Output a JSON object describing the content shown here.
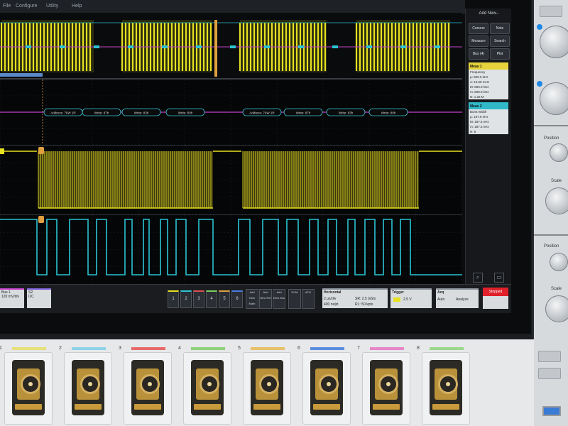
{
  "menu": {
    "items": [
      "File",
      "Configure",
      "Utility",
      "Help"
    ]
  },
  "side_panel": {
    "title": "Add New...",
    "buttons": [
      "Cursors",
      "Note",
      "Measure",
      "Search",
      "Bus (4)",
      "Plot"
    ]
  },
  "meas_badges": [
    {
      "header": "Meas 1",
      "rows": [
        "Frequency",
        "μ: 800.0 kHz",
        "σ: 10.68 mHz",
        "M: 800.0 kHz",
        "m: 800.0 kHz",
        "N: 1.25 M"
      ]
    },
    {
      "header": "Meas 2",
      "rows": [
        "Burst Width",
        "μ: 187.5 nHz",
        "M: 187.6 nHz",
        "m: 187.5 nHz",
        "N: 6"
      ]
    }
  ],
  "bus_labels": [
    "Address: 76W 1R",
    "Write: 87h",
    "Write: 83h",
    "Write: 80h",
    "Address: 74W 1R",
    "Write: 87h",
    "Write: 83h",
    "Write: 80h"
  ],
  "bottom_bar": {
    "ch_left": {
      "title": "Bus 1",
      "value": "120 mV/div"
    },
    "ch_left2": {
      "title": "S2",
      "value": "I2C"
    },
    "channel_buttons": [
      "1",
      "2",
      "3",
      "4",
      "5",
      "6"
    ],
    "small_buttons": [
      "Add New Math",
      "Add New Ref",
      "Add New Bus",
      "DVM",
      "AFG"
    ],
    "horizontal": {
      "title": "Horizontal",
      "row1": "2 μs/div",
      "row2": "SR: 2.5 GS/s",
      "row3": "400 ns/pt",
      "row4": "RL: 50 kpts"
    },
    "trigger": {
      "title": "Trigger",
      "value": "2.5 V"
    },
    "acquisition": {
      "title": "Acq",
      "row1": "Auto",
      "row2": "Analyze"
    },
    "stop": "Stopped"
  },
  "right_panel": {
    "labels": [
      "Position",
      "Scale",
      "Position",
      "Scale"
    ]
  },
  "probes": [
    "1",
    "2",
    "3",
    "4",
    "5",
    "6",
    "7",
    "8"
  ],
  "colors": {
    "ch1_yellow": "#e6e020",
    "ch2_cyan": "#2bc4d4",
    "bus_magenta": "#c040c8",
    "probe_strips": [
      "#e8e07a",
      "#8dd3e8",
      "#e86a6a",
      "#8fd07a",
      "#e8c06a",
      "#5a8ee0",
      "#e886c8",
      "#9ad88a"
    ]
  }
}
